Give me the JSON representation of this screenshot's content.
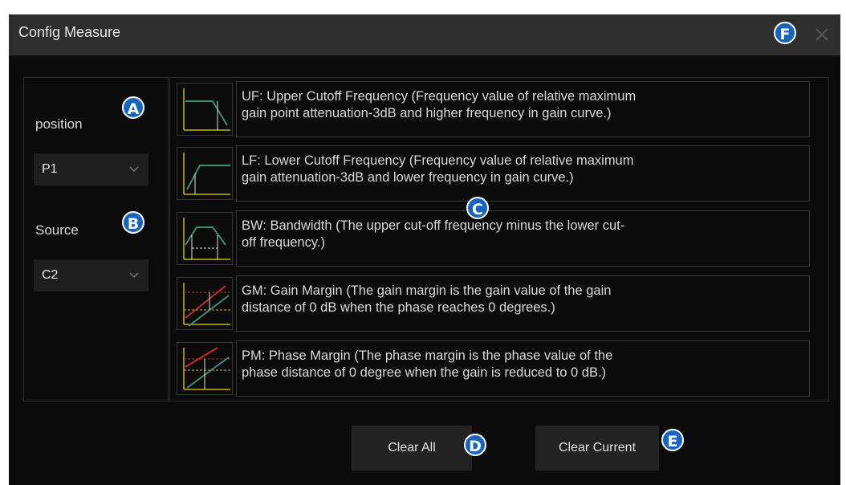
{
  "window": {
    "title": "Config Measure"
  },
  "position": {
    "label": "position",
    "value": "P1"
  },
  "source": {
    "label": "Source",
    "value": "C2"
  },
  "measurements": [
    {
      "line1": "UF: Upper Cutoff Frequency (Frequency value of relative maximum",
      "line2": "gain point attenuation-3dB and higher frequency in gain curve.)",
      "icon": "upper-cutoff-icon"
    },
    {
      "line1": "LF: Lower Cutoff Frequency (Frequency value of relative maximum",
      "line2": "gain attenuation-3dB and lower frequency in gain curve.)",
      "icon": "lower-cutoff-icon"
    },
    {
      "line1": "BW: Bandwidth (The upper cut-off frequency minus the lower cut-",
      "line2": "off frequency.)",
      "icon": "bandwidth-icon"
    },
    {
      "line1": "GM: Gain Margin (The gain margin is the gain value of the gain",
      "line2": "distance of 0 dB when the phase reaches 0 degrees.)",
      "icon": "gain-margin-icon"
    },
    {
      "line1": "PM: Phase Margin (The phase margin is the phase value of the",
      "line2": "phase distance of 0 degree when the gain is reduced to 0 dB.)",
      "icon": "phase-margin-icon"
    }
  ],
  "buttons": {
    "clear_all": "Clear All",
    "clear_current": "Clear Current"
  },
  "callouts": {
    "a": "A",
    "b": "B",
    "c": "C",
    "d": "D",
    "e": "E",
    "f": "F"
  },
  "colors": {
    "badge": "#1565c0",
    "curve": "#3a8a7a",
    "axis": "#c8b400",
    "red": "#c62828"
  }
}
